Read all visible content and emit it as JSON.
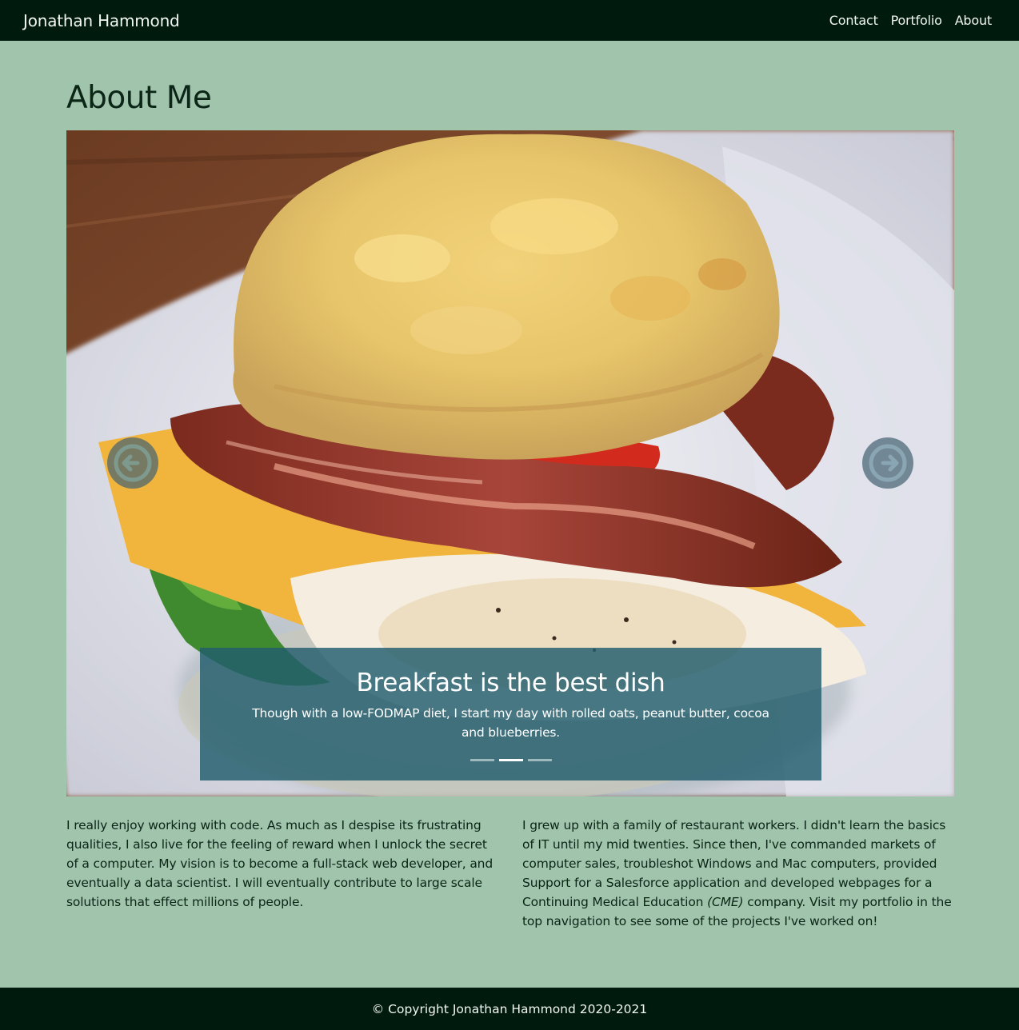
{
  "navbar": {
    "brand": "Jonathan Hammond",
    "links": [
      "Contact",
      "Portfolio",
      "About"
    ]
  },
  "page": {
    "title": "About Me"
  },
  "carousel": {
    "caption_title": "Breakfast is the best dish",
    "caption_text": "Though with a low-FODMAP diet, I start my day with rolled oats, peanut butter, cocoa and blueberries.",
    "slide_count": 3,
    "active_slide": 2,
    "prev_icon": "arrow-left-circle-icon",
    "next_icon": "arrow-right-circle-icon"
  },
  "content": {
    "left_paragraph": "I really enjoy working with code. As much as I despise its frustrating qualities, I also live for the feeling of reward when I unlock the secret of a computer. My vision is to become a full-stack web developer, and eventually a data scientist. I will eventually contribute to large scale solutions that effect millions of people.",
    "right_paragraph_before": "I grew up with a family of restaurant workers. I didn't learn the basics of IT until my mid twenties. Since then, I've commanded markets of computer sales, troubleshot Windows and Mac computers, provided Support for a Salesforce application and developed webpages for a Continuing Medical Education ",
    "right_paragraph_em": "(CME)",
    "right_paragraph_after": " company. Visit my portfolio in the top navigation to see some of the projects I've worked on!"
  },
  "footer": {
    "copyright": "© Copyright Jonathan Hammond 2020-2021"
  },
  "colors": {
    "background": "#a1c4ac",
    "navbar": "#001b0e",
    "caption_bg": "#215d6c",
    "text": "#0b2517"
  }
}
